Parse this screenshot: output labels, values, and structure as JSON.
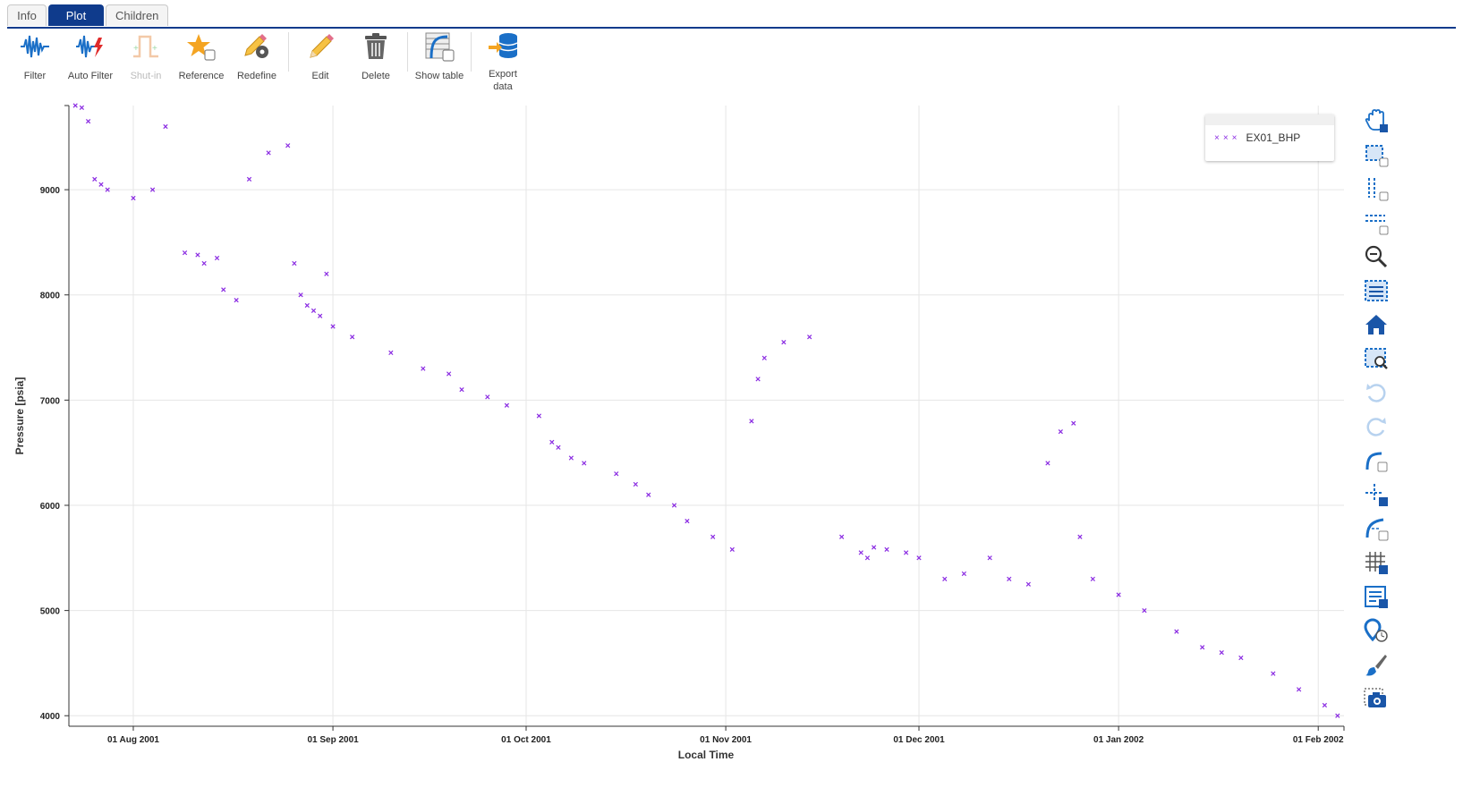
{
  "tabs": [
    {
      "label": "Info",
      "active": false
    },
    {
      "label": "Plot",
      "active": true
    },
    {
      "label": "Children",
      "active": false
    }
  ],
  "toolbar": {
    "filter": "Filter",
    "auto_filter": "Auto Filter",
    "shut_in": "Shut-in",
    "reference": "Reference",
    "redefine": "Redefine",
    "edit": "Edit",
    "delete": "Delete",
    "show_table": "Show table",
    "export_line1": "Export",
    "export_line2": "data"
  },
  "legend": {
    "label": "EX01_BHP"
  },
  "right_tools": [
    "pan-icon",
    "box-zoom-icon",
    "x-zoom-icon",
    "y-zoom-icon",
    "zoom-out-icon",
    "box-select-icon",
    "home-icon",
    "zoom-fit-icon",
    "undo-icon",
    "redo-icon",
    "curve-icon",
    "crosshair-icon",
    "fit-curve-icon",
    "grid-icon",
    "legend-icon",
    "hover-icon",
    "brush-icon",
    "camera-icon"
  ],
  "colors": {
    "series": "#8a2be2",
    "accent": "#0f3b8c",
    "grid": "#e6e6e6"
  },
  "chart_data": {
    "type": "scatter",
    "xlabel": "Local Time",
    "ylabel": "Pressure [psia]",
    "x_ticks": [
      "01 Aug 2001",
      "01 Sep 2001",
      "01 Oct 2001",
      "01 Nov 2001",
      "01 Dec 2001",
      "01 Jan 2002",
      "01 Feb 2002"
    ],
    "y_ticks": [
      "4000",
      "5000",
      "6000",
      "7000",
      "8000",
      "9000"
    ],
    "xlim": [
      "2001-07-22",
      "2002-02-05"
    ],
    "ylim": [
      3900,
      9800
    ],
    "grid": true,
    "legend_position": "top-right",
    "series": [
      {
        "name": "EX01_BHP",
        "marker": "x",
        "x": [
          "2001-07-23",
          "2001-07-24",
          "2001-07-25",
          "2001-07-26",
          "2001-07-27",
          "2001-07-28",
          "2001-08-01",
          "2001-08-04",
          "2001-08-06",
          "2001-08-09",
          "2001-08-11",
          "2001-08-12",
          "2001-08-14",
          "2001-08-15",
          "2001-08-17",
          "2001-08-19",
          "2001-08-22",
          "2001-08-25",
          "2001-08-26",
          "2001-08-27",
          "2001-08-28",
          "2001-08-29",
          "2001-08-30",
          "2001-08-31",
          "2001-09-01",
          "2001-09-04",
          "2001-09-10",
          "2001-09-15",
          "2001-09-19",
          "2001-09-21",
          "2001-09-25",
          "2001-09-28",
          "2001-10-03",
          "2001-10-05",
          "2001-10-06",
          "2001-10-08",
          "2001-10-10",
          "2001-10-15",
          "2001-10-18",
          "2001-10-20",
          "2001-10-24",
          "2001-10-26",
          "2001-10-30",
          "2001-11-02",
          "2001-11-05",
          "2001-11-06",
          "2001-11-07",
          "2001-11-10",
          "2001-11-14",
          "2001-11-19",
          "2001-11-22",
          "2001-11-23",
          "2001-11-24",
          "2001-11-26",
          "2001-11-29",
          "2001-12-01",
          "2001-12-05",
          "2001-12-08",
          "2001-12-12",
          "2001-12-15",
          "2001-12-18",
          "2001-12-21",
          "2001-12-23",
          "2001-12-25",
          "2001-12-26",
          "2001-12-28",
          "2002-01-01",
          "2002-01-05",
          "2002-01-10",
          "2002-01-14",
          "2002-01-17",
          "2002-01-20",
          "2002-01-25",
          "2002-01-29",
          "2002-02-02",
          "2002-02-04"
        ],
        "y": [
          9800,
          9780,
          9650,
          9100,
          9050,
          9000,
          8920,
          9000,
          9600,
          8400,
          8380,
          8300,
          8350,
          8050,
          7950,
          9100,
          9350,
          9420,
          8300,
          8000,
          7900,
          7850,
          7800,
          8200,
          7700,
          7600,
          7450,
          7300,
          7250,
          7100,
          7030,
          6950,
          6850,
          6600,
          6550,
          6450,
          6400,
          6300,
          6200,
          6100,
          6000,
          5850,
          5700,
          5580,
          6800,
          7200,
          7400,
          7550,
          7600,
          5700,
          5550,
          5500,
          5600,
          5580,
          5550,
          5500,
          5300,
          5350,
          5500,
          5300,
          5250,
          6400,
          6700,
          6780,
          5700,
          5300,
          5150,
          5000,
          4800,
          4650,
          4600,
          4550,
          4400,
          4250,
          4100,
          4000
        ]
      }
    ]
  }
}
